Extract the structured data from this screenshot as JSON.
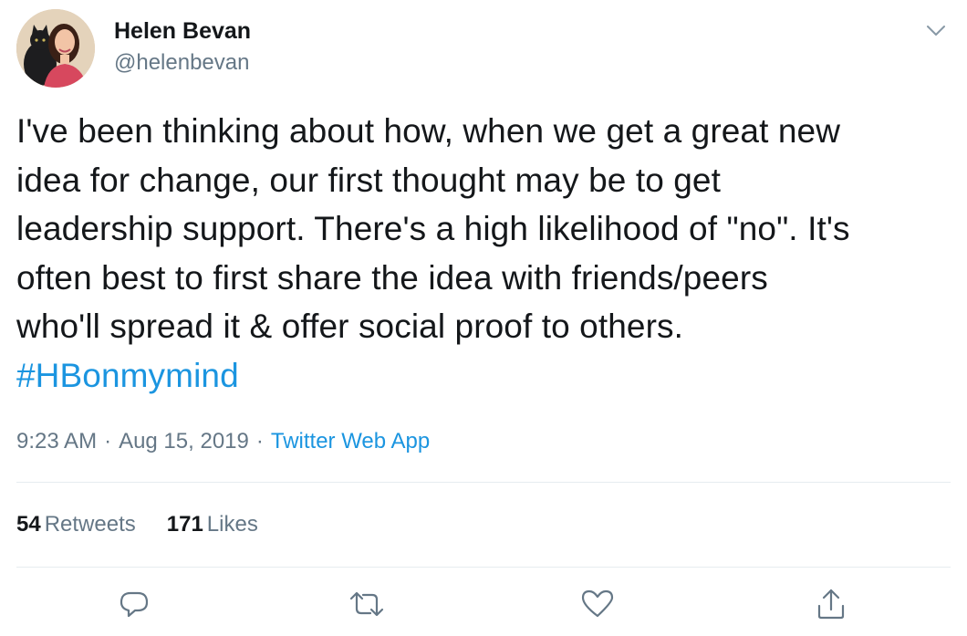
{
  "author": {
    "display_name": "Helen Bevan",
    "handle": "@helenbevan",
    "avatar_icon": "profile-photo-avatar"
  },
  "menu_icon": "chevron-down-icon",
  "tweet": {
    "lines": [
      "I've been thinking about how, when we get a great new",
      "idea for change, our first thought may be to get",
      "leadership support. There's a high likelihood of \"no\". It's",
      "often best to first share the idea with friends/peers",
      "who'll spread it & offer social proof to others."
    ],
    "hashtag": "#HBonmymind"
  },
  "meta": {
    "time": "9:23 AM",
    "separator": "·",
    "date": "Aug 15, 2019",
    "source": "Twitter Web App"
  },
  "stats": {
    "retweets_count": "54",
    "retweets_label": "Retweets",
    "likes_count": "171",
    "likes_label": "Likes"
  },
  "actions": [
    {
      "icon": "reply-icon"
    },
    {
      "icon": "retweet-icon"
    },
    {
      "icon": "like-heart-icon"
    },
    {
      "icon": "share-icon"
    }
  ],
  "colors": {
    "text": "#14171a",
    "secondary": "#657786",
    "link": "#1b95e0",
    "divider": "#e6ecf0"
  }
}
